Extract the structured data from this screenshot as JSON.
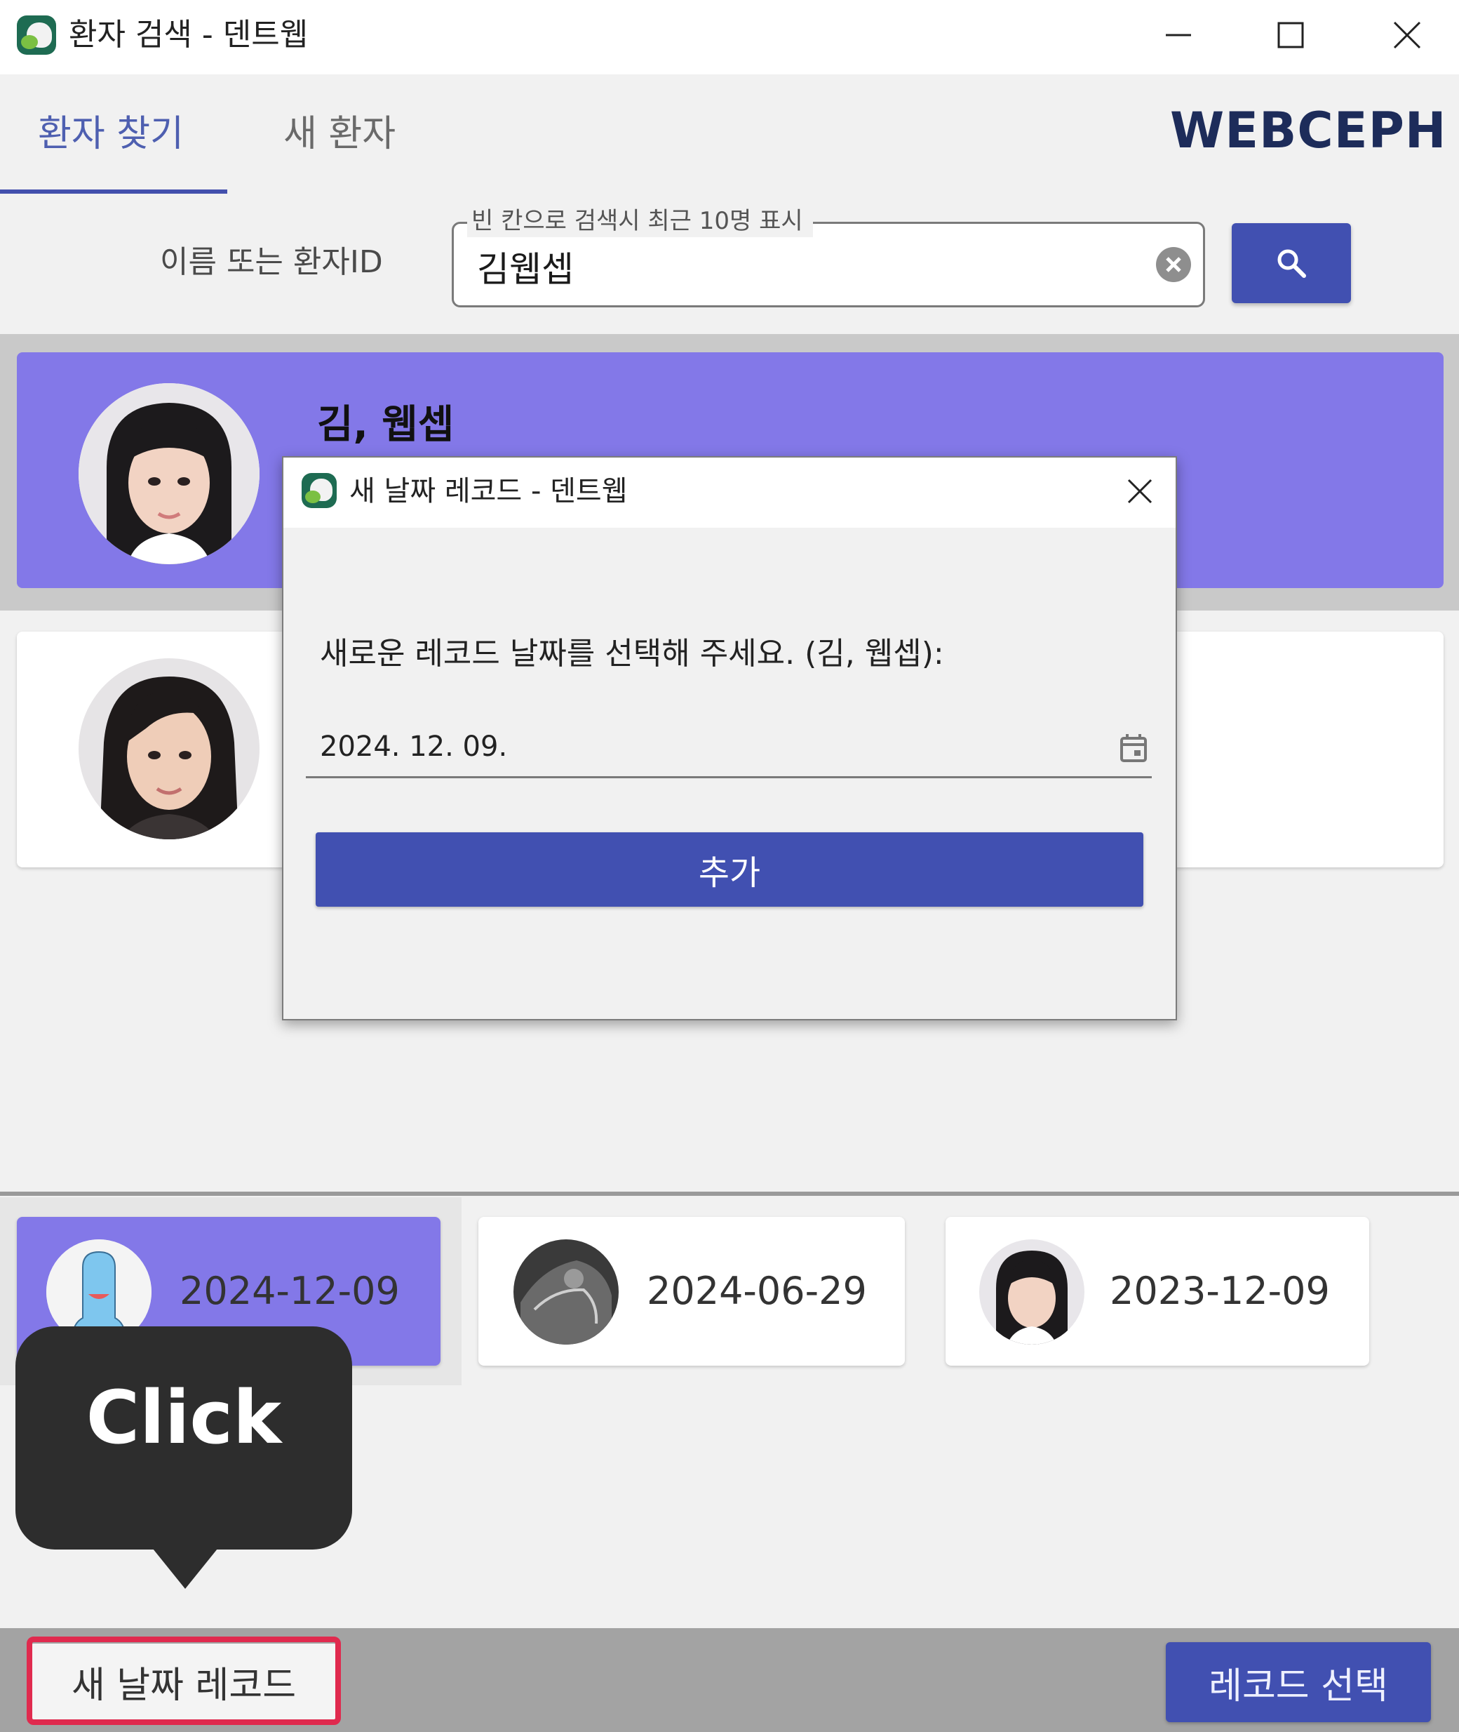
{
  "window": {
    "title": "환자 검색 - 덴트웹",
    "minimize_icon": "minimize-icon",
    "maximize_icon": "maximize-icon",
    "close_icon": "close-icon"
  },
  "tabs": [
    {
      "label": "환자 찾기",
      "active": true
    },
    {
      "label": "새 환자",
      "active": false
    }
  ],
  "brand": "WEBCEPH",
  "search": {
    "label": "이름 또는 환자ID",
    "hint": "빈 칸으로 검색시 최근 10명 표시",
    "value": "김웹셉",
    "clear_icon": "clear-circle-icon",
    "button_icon": "search-icon"
  },
  "results": [
    {
      "name": "김, 웹셉",
      "selected": true
    },
    {
      "name": "",
      "selected": false
    }
  ],
  "records": [
    {
      "date": "2024-12-09",
      "selected": true,
      "thumb": "default-face-avatar"
    },
    {
      "date": "2024-06-29",
      "selected": false,
      "thumb": "xray-thumbnail"
    },
    {
      "date": "2023-12-09",
      "selected": false,
      "thumb": "patient-photo"
    }
  ],
  "callout": {
    "text": "Click"
  },
  "bottom_bar": {
    "new_record_label": "새 날짜 레코드",
    "select_record_label": "레코드 선택"
  },
  "dialog": {
    "title": "새 날짜 레코드 - 덴트웹",
    "prompt": "새로운 레코드 날짜를 선택해 주세요. (김, 웹셉):",
    "date_value": "2024. 12. 09.",
    "calendar_icon": "calendar-icon",
    "add_label": "추가"
  },
  "colors": {
    "accent": "#4150b1",
    "selected_card": "#8378e8",
    "highlight": "#e02a4e",
    "brand": "#1d2c5a"
  }
}
